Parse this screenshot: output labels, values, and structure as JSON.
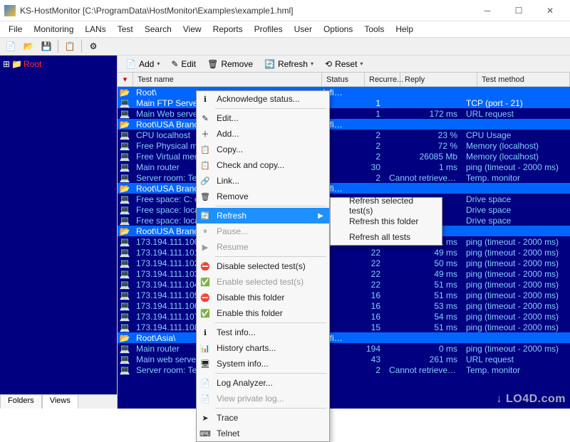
{
  "titlebar": {
    "title": "KS-HostMonitor   [C:\\ProgramData\\HostMonitor\\Examples\\example1.hml]"
  },
  "menubar": [
    "File",
    "Monitoring",
    "LANs",
    "Test",
    "Search",
    "View",
    "Reports",
    "Profiles",
    "User",
    "Options",
    "Tools",
    "Help"
  ],
  "sidebar": {
    "root_label": "Root",
    "tabs": [
      "Folders",
      "Views"
    ],
    "active_tab": 1
  },
  "main_toolbar": {
    "add": "Add",
    "edit": "Edit",
    "remove": "Remove",
    "refresh": "Refresh",
    "reset": "Reset"
  },
  "grid": {
    "columns": {
      "name": "Test name",
      "status": "Status",
      "recur": "Recurre...",
      "reply": "Reply",
      "method": "Test method"
    },
    "rows": [
      {
        "type": "folder",
        "sel": true,
        "name": "Root\\"
      },
      {
        "type": "test",
        "sel": true,
        "name": "Main FTP Server",
        "status": "",
        "recur": "1",
        "reply": "",
        "method": "TCP (port - 21)"
      },
      {
        "type": "test",
        "name": "Main Web server",
        "status": "",
        "recur": "1",
        "reply": "172 ms",
        "method": "URL request"
      },
      {
        "type": "folder",
        "sel": true,
        "name": "Root\\USA Branc"
      },
      {
        "type": "test",
        "name": "CPU localhost",
        "status": "",
        "recur": "2",
        "reply": "23 %",
        "method": "CPU Usage"
      },
      {
        "type": "test",
        "name": "Free Physical mem",
        "status": "",
        "recur": "2",
        "reply": "72 %",
        "method": "Memory (localhost)"
      },
      {
        "type": "test",
        "name": "Free Virtual mem",
        "status": "",
        "recur": "2",
        "reply": "26085 Mb",
        "method": "Memory (localhost)"
      },
      {
        "type": "test",
        "name": "Main router",
        "status": "",
        "recur": "30",
        "reply": "1 ms",
        "method": "ping (timeout - 2000 ms)"
      },
      {
        "type": "test",
        "name": "Server room: Tem",
        "status": "",
        "recur": "2",
        "reply": "Cannot retrieve data f...",
        "method": "Temp. monitor"
      },
      {
        "type": "folder",
        "sel": true,
        "name": "Root\\USA Branc"
      },
      {
        "type": "test",
        "name": "Free space: C: or",
        "status": "",
        "recur": "",
        "reply": "",
        "method": "Drive space"
      },
      {
        "type": "test",
        "name": "Free space: local",
        "status": "",
        "recur": "",
        "reply": "",
        "method": "Drive space"
      },
      {
        "type": "test",
        "name": "Free space: local",
        "status": "",
        "recur": "",
        "reply": "",
        "method": "Drive space"
      },
      {
        "type": "folder",
        "sel": true,
        "name": "Root\\USA Branc"
      },
      {
        "type": "test",
        "name": "173.194.111.100",
        "status": "",
        "recur": "22",
        "reply": "51 ms",
        "method": "ping (timeout - 2000 ms)"
      },
      {
        "type": "test",
        "name": "173.194.111.101",
        "status": "",
        "recur": "22",
        "reply": "49 ms",
        "method": "ping (timeout - 2000 ms)"
      },
      {
        "type": "test",
        "name": "173.194.111.102",
        "status": "",
        "recur": "22",
        "reply": "50 ms",
        "method": "ping (timeout - 2000 ms)"
      },
      {
        "type": "test",
        "name": "173.194.111.103",
        "status": "",
        "recur": "22",
        "reply": "49 ms",
        "method": "ping (timeout - 2000 ms)"
      },
      {
        "type": "test",
        "name": "173.194.111.104",
        "status": "",
        "recur": "22",
        "reply": "51 ms",
        "method": "ping (timeout - 2000 ms)"
      },
      {
        "type": "test",
        "name": "173.194.111.105",
        "status": "",
        "recur": "16",
        "reply": "51 ms",
        "method": "ping (timeout - 2000 ms)"
      },
      {
        "type": "test",
        "name": "173.194.111.106",
        "status": "",
        "recur": "16",
        "reply": "53 ms",
        "method": "ping (timeout - 2000 ms)"
      },
      {
        "type": "test",
        "name": "173.194.111.107",
        "status": "",
        "recur": "16",
        "reply": "54 ms",
        "method": "ping (timeout - 2000 ms)"
      },
      {
        "type": "test",
        "name": "173.194.111.108",
        "status": "",
        "recur": "15",
        "reply": "51 ms",
        "method": "ping (timeout - 2000 ms)"
      },
      {
        "type": "folder",
        "sel": true,
        "name": "Root\\Asia\\"
      },
      {
        "type": "test",
        "name": "Main router",
        "status": "",
        "recur": "194",
        "reply": "0 ms",
        "method": "ping (timeout - 2000 ms)"
      },
      {
        "type": "test",
        "name": "Main web server",
        "status": "",
        "recur": "43",
        "reply": "261 ms",
        "method": "URL request"
      },
      {
        "type": "test",
        "name": "Server room: Tem",
        "status": "",
        "recur": "2",
        "reply": "Cannot retrieve data f...",
        "method": "Temp. monitor"
      }
    ]
  },
  "context_menu": {
    "items": [
      {
        "icon": "info",
        "label": "Acknowledge status..."
      },
      {
        "sep": true
      },
      {
        "icon": "edit",
        "label": "Edit..."
      },
      {
        "icon": "add",
        "label": "Add..."
      },
      {
        "icon": "copy",
        "label": "Copy..."
      },
      {
        "icon": "copy",
        "label": "Check and copy..."
      },
      {
        "icon": "link",
        "label": "Link..."
      },
      {
        "icon": "remove",
        "label": "Remove"
      },
      {
        "sep": true
      },
      {
        "icon": "refresh",
        "label": "Refresh",
        "submenu": true,
        "hl": true
      },
      {
        "icon": "pause",
        "label": "Pause...",
        "disabled": true
      },
      {
        "icon": "resume",
        "label": "Resume",
        "disabled": true
      },
      {
        "sep": true
      },
      {
        "icon": "disable",
        "label": "Disable selected test(s)"
      },
      {
        "icon": "enable",
        "label": "Enable selected test(s)",
        "disabled": true
      },
      {
        "icon": "disable-folder",
        "label": "Disable this folder"
      },
      {
        "icon": "enable-folder",
        "label": "Enable this folder"
      },
      {
        "sep": true
      },
      {
        "icon": "info",
        "label": "Test info..."
      },
      {
        "icon": "chart",
        "label": "History charts..."
      },
      {
        "icon": "system",
        "label": "System info..."
      },
      {
        "sep": true
      },
      {
        "icon": "log",
        "label": "Log Analyzer..."
      },
      {
        "icon": "log",
        "label": "View private log...",
        "disabled": true
      },
      {
        "sep": true
      },
      {
        "icon": "trace",
        "label": "Trace"
      },
      {
        "icon": "telnet",
        "label": "Telnet"
      }
    ]
  },
  "submenu": {
    "items": [
      "Refresh selected test(s)",
      "Refresh this folder",
      "Refresh all tests"
    ]
  },
  "watermark": "↓ LO4D.com"
}
